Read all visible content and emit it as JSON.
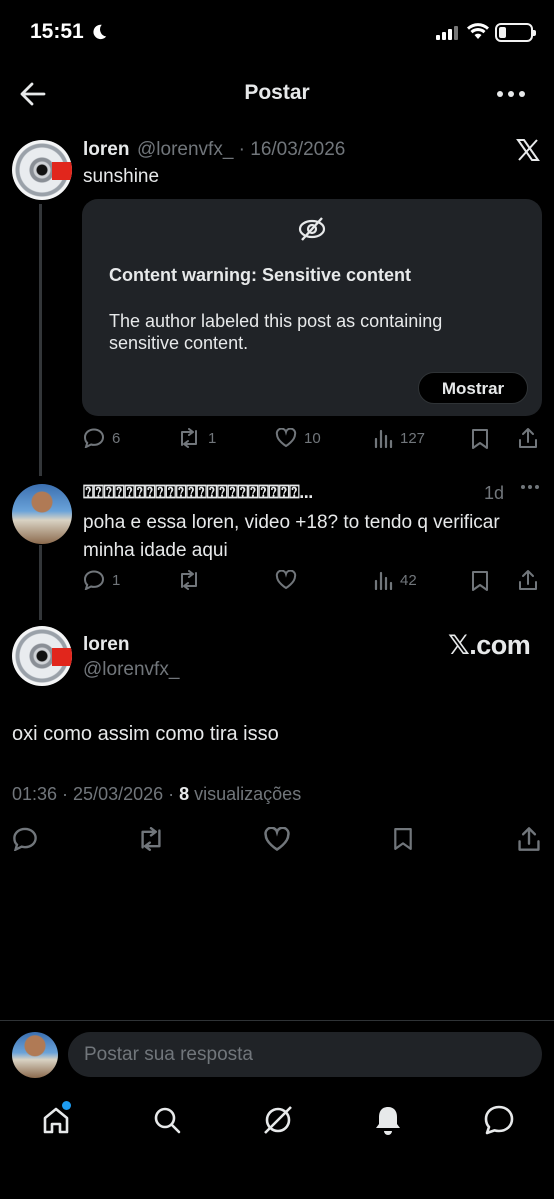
{
  "status_bar": {
    "time": "15:51"
  },
  "header": {
    "title": "Postar"
  },
  "post1": {
    "display_name": "loren",
    "handle_date": "@lorenvfx_ · 16/03/2026",
    "text": "sunshine",
    "warning": {
      "title": "Content warning: Sensitive content",
      "description": "The author labeled this post as containing sensitive content.",
      "button": "Mostrar"
    },
    "actions": {
      "replies": "6",
      "reposts": "1",
      "likes": "10",
      "views": "127"
    }
  },
  "post2": {
    "display_name": "⍰⍰⍰⍰⍰⍰⍰⍰⍰⍰⍰⍰⍰⍰⍰⍰⍰⍰⍰⍰⍰...",
    "time": "1d",
    "text": "poha e essa loren, video +18? to tendo q verificar minha idade aqui",
    "actions": {
      "replies": "1",
      "reposts": "",
      "likes": "",
      "views": "42"
    }
  },
  "post3": {
    "display_name": "loren",
    "handle": "@lorenvfx_",
    "brand": "𝕏.com",
    "text": "oxi como assim como tira isso",
    "meta_time": "01:36 · 25/03/2026 · ",
    "meta_views_count": "8",
    "meta_views_label": " visualizações"
  },
  "composer": {
    "placeholder": "Postar sua resposta"
  },
  "icons": [
    "back-arrow-icon",
    "more-icon",
    "x-logo-icon",
    "eye-slash-icon",
    "reply-icon",
    "repost-icon",
    "like-icon",
    "views-icon",
    "bookmark-icon",
    "share-icon",
    "home-icon",
    "search-icon",
    "grok-icon",
    "bell-icon",
    "messages-icon"
  ],
  "colors": {
    "background": "#000000",
    "text": "#e7e9ea",
    "muted": "#71767b",
    "card": "#202327",
    "accent_dot": "#1d9bf0"
  }
}
